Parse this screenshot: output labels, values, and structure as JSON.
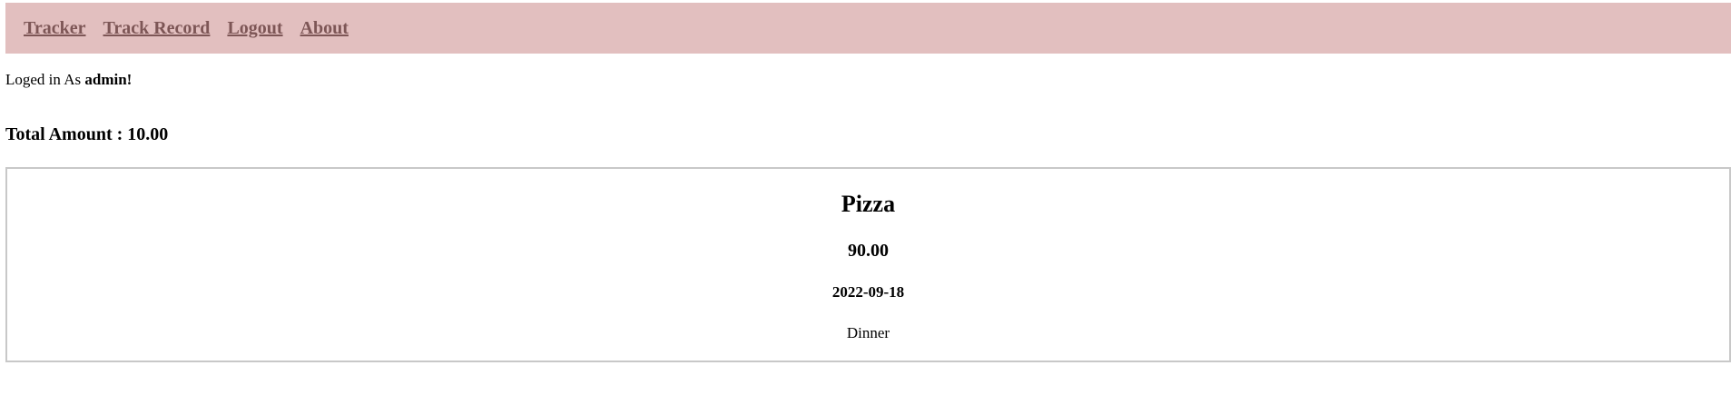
{
  "nav": {
    "items": [
      {
        "label": "Tracker"
      },
      {
        "label": "Track Record"
      },
      {
        "label": "Logout"
      },
      {
        "label": "About"
      }
    ]
  },
  "session": {
    "prefix": "Loged in As",
    "username": "admin!"
  },
  "summary": {
    "total_label": "Total Amount : 10.00"
  },
  "record": {
    "name": "Pizza",
    "price": "90.00",
    "date": "2022-09-18",
    "meal": "Dinner"
  },
  "colors": {
    "navbar_bg": "#e2bfbf",
    "nav_link": "#7d5656",
    "card_border": "#c8c8c8"
  }
}
